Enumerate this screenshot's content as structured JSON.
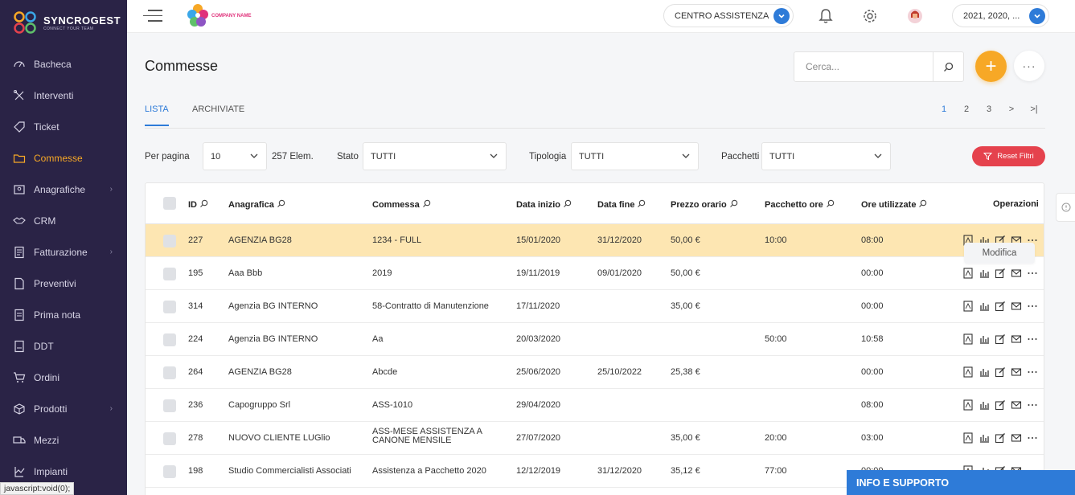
{
  "brand": {
    "name": "SYNCROGEST",
    "tagline": "CONNECT YOUR TEAM"
  },
  "sidebar": {
    "items": [
      {
        "label": "Bacheca",
        "icon": "dashboard-icon",
        "active": false,
        "chevron": false
      },
      {
        "label": "Interventi",
        "icon": "tools-icon",
        "active": false,
        "chevron": false
      },
      {
        "label": "Ticket",
        "icon": "tag-icon",
        "active": false,
        "chevron": false
      },
      {
        "label": "Commesse",
        "icon": "folder-icon",
        "active": true,
        "chevron": false
      },
      {
        "label": "Anagrafiche",
        "icon": "contacts-icon",
        "active": false,
        "chevron": true
      },
      {
        "label": "CRM",
        "icon": "handshake-icon",
        "active": false,
        "chevron": false
      },
      {
        "label": "Fatturazione",
        "icon": "invoice-icon",
        "active": false,
        "chevron": true
      },
      {
        "label": "Preventivi",
        "icon": "quote-icon",
        "active": false,
        "chevron": false
      },
      {
        "label": "Prima nota",
        "icon": "ledger-icon",
        "active": false,
        "chevron": false
      },
      {
        "label": "DDT",
        "icon": "document-icon",
        "active": false,
        "chevron": false
      },
      {
        "label": "Ordini",
        "icon": "cart-icon",
        "active": false,
        "chevron": false
      },
      {
        "label": "Prodotti",
        "icon": "box-icon",
        "active": false,
        "chevron": true
      },
      {
        "label": "Mezzi",
        "icon": "truck-icon",
        "active": false,
        "chevron": false
      },
      {
        "label": "Impianti",
        "icon": "plant-icon",
        "active": false,
        "chevron": false
      }
    ]
  },
  "topbar": {
    "company_logo_text": "COMPANY NAME",
    "assistance_select": "CENTRO ASSISTENZA",
    "years_select": "2021, 2020, ..."
  },
  "page": {
    "title": "Commesse",
    "search_placeholder": "Cerca...",
    "add_label": "+",
    "more_label": "···"
  },
  "tabs": [
    {
      "label": "LISTA",
      "active": true
    },
    {
      "label": "ARCHIVIATE",
      "active": false
    }
  ],
  "pager": [
    "1",
    "2",
    "3",
    ">",
    ">|"
  ],
  "filters": {
    "per_page_label": "Per pagina",
    "per_page_value": "10",
    "count": "257 Elem.",
    "stato_label": "Stato",
    "stato_value": "TUTTI",
    "tipologia_label": "Tipologia",
    "tipologia_value": "TUTTI",
    "pacchetti_label": "Pacchetti",
    "pacchetti_value": "TUTTI",
    "reset_label": "Reset Filtri"
  },
  "table": {
    "columns": [
      "ID",
      "Anagrafica",
      "Commessa",
      "Data inizio",
      "Data fine",
      "Prezzo orario",
      "Pacchetto ore",
      "Ore utilizzate",
      "Operazioni"
    ],
    "rows": [
      {
        "id": "227",
        "anagrafica": "AGENZIA BG28",
        "commessa": "1234 - FULL",
        "inizio": "15/01/2020",
        "fine": "31/12/2020",
        "prezzo": "50,00 €",
        "pacchetto": "10:00",
        "ore": "08:00",
        "highlight": true
      },
      {
        "id": "195",
        "anagrafica": "Aaa Bbb",
        "commessa": "2019",
        "inizio": "19/11/2019",
        "fine": "09/01/2020",
        "prezzo": "50,00 €",
        "pacchetto": "",
        "ore": "00:00",
        "highlight": false
      },
      {
        "id": "314",
        "anagrafica": "Agenzia BG INTERNO",
        "commessa": "58-Contratto di Manutenzione",
        "inizio": "17/11/2020",
        "fine": "",
        "prezzo": "35,00 €",
        "pacchetto": "",
        "ore": "00:00",
        "highlight": false
      },
      {
        "id": "224",
        "anagrafica": "Agenzia BG INTERNO",
        "commessa": "Aa",
        "inizio": "20/03/2020",
        "fine": "",
        "prezzo": "",
        "pacchetto": "50:00",
        "ore": "10:58",
        "highlight": false
      },
      {
        "id": "264",
        "anagrafica": "AGENZIA BG28",
        "commessa": "Abcde",
        "inizio": "25/06/2020",
        "fine": "25/10/2022",
        "prezzo": "25,38 €",
        "pacchetto": "",
        "ore": "00:00",
        "highlight": false
      },
      {
        "id": "236",
        "anagrafica": "Capogruppo Srl",
        "commessa": "ASS-1010",
        "inizio": "29/04/2020",
        "fine": "",
        "prezzo": "",
        "pacchetto": "",
        "ore": "08:00",
        "highlight": false
      },
      {
        "id": "278",
        "anagrafica": "NUOVO CLIENTE LUGlio",
        "commessa": "ASS-MESE ASSISTENZA A CANONE MENSILE",
        "inizio": "27/07/2020",
        "fine": "",
        "prezzo": "35,00 €",
        "pacchetto": "20:00",
        "ore": "03:00",
        "highlight": false
      },
      {
        "id": "198",
        "anagrafica": "Studio Commercialisti Associati",
        "commessa": "Assistenza a Pacchetto 2020",
        "inizio": "12/12/2019",
        "fine": "31/12/2020",
        "prezzo": "35,12 €",
        "pacchetto": "77:00",
        "ore": "00:00",
        "highlight": false
      }
    ],
    "tooltip": "Modifica"
  },
  "support_label": "INFO E SUPPORTO",
  "status_url": "javascript:void(0);",
  "colors": {
    "sidebar": "#2a2346",
    "accent": "#f7a826",
    "primary": "#2e7bd8",
    "danger": "#e5424d",
    "highlight_row": "#fde6b2"
  }
}
